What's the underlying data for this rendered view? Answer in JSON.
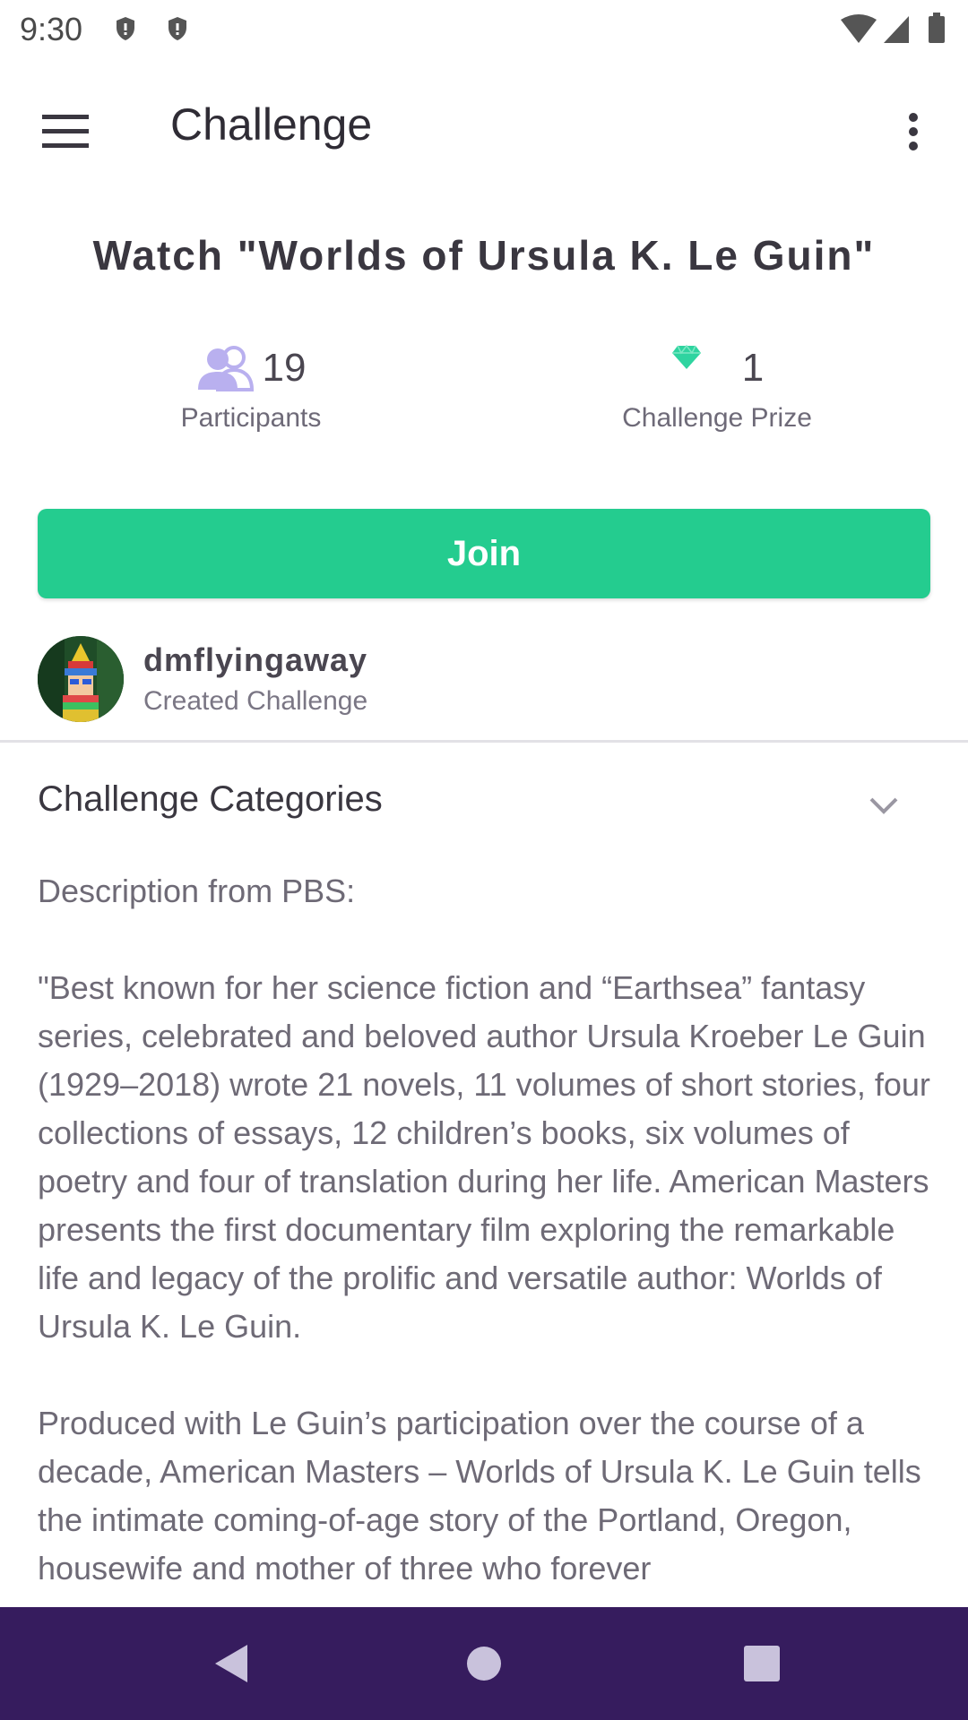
{
  "status_bar": {
    "time": "9:30",
    "icons": [
      "shield-icon",
      "shield-icon",
      "wifi-icon",
      "signal-icon",
      "battery-icon"
    ]
  },
  "app_bar": {
    "title": "Challenge",
    "menu_icon": "hamburger-menu-icon",
    "more_icon": "more-vertical-icon"
  },
  "challenge": {
    "title": "Watch \"Worlds of Ursula K. Le Guin\"",
    "participants_count": "19",
    "participants_label": "Participants",
    "prize_count": "1",
    "prize_label": "Challenge Prize",
    "join_label": "Join"
  },
  "creator": {
    "name": "dmflyingaway",
    "subtitle": "Created Challenge"
  },
  "categories": {
    "label": "Challenge Categories"
  },
  "description": {
    "text": "Description from PBS:\n\n\"Best known for her science fiction and “Earthsea” fantasy series, celebrated and beloved author Ursula Kroeber Le Guin (1929–2018) wrote 21 novels, 11 volumes of short stories, four collections of essays, 12 children’s books, six volumes of poetry and four of translation during her life. American Masters presents the first documentary film exploring the remarkable life and legacy of the prolific and versatile author: Worlds of Ursula K. Le Guin.\n\nProduced with Le Guin’s participation over the course of a decade, American Masters – Worlds of Ursula K. Le Guin tells the intimate coming-of-age story of the Portland, Oregon, housewife and mother of three who forever"
  },
  "colors": {
    "accent_green": "#24cc8f",
    "participants_icon": "#b9b0ef",
    "gem": "#2fd4a0",
    "nav_bar": "#361c5e"
  }
}
